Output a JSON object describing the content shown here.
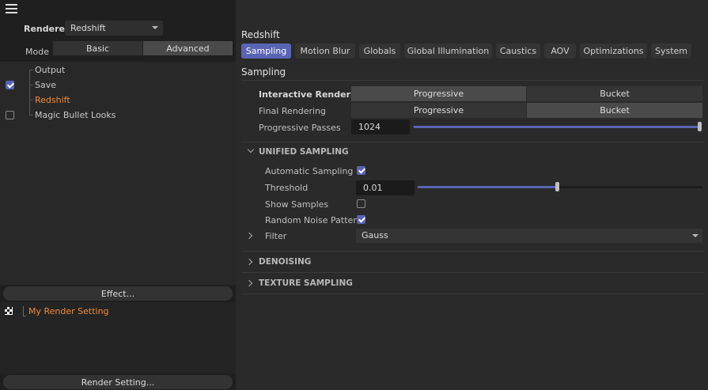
{
  "left": {
    "renderer_label": "Renderer",
    "renderer_value": "Redshift",
    "mode_label": "Mode",
    "mode_options": [
      "Basic",
      "Advanced"
    ],
    "mode_selected": "Advanced",
    "tree": [
      {
        "label": "Output",
        "checkbox": null
      },
      {
        "label": "Save",
        "checkbox": true
      },
      {
        "label": "Redshift",
        "checkbox": null,
        "highlighted": true
      },
      {
        "label": "Magic Bullet Looks",
        "checkbox": false
      }
    ],
    "effect_button": "Effect...",
    "render_settings": [
      "My Render Setting"
    ],
    "render_setting_button": "Render Setting..."
  },
  "right": {
    "title": "Redshift",
    "tabs": [
      "Sampling",
      "Motion Blur",
      "Globals",
      "Global Illumination",
      "Caustics",
      "AOV",
      "Optimizations",
      "System"
    ],
    "active_tab": "Sampling",
    "section": "Sampling",
    "interactive_rendering": {
      "label": "Interactive Rendering",
      "options": [
        "Progressive",
        "Bucket"
      ],
      "selected": "Progressive"
    },
    "final_rendering": {
      "label": "Final Rendering",
      "options": [
        "Progressive",
        "Bucket"
      ],
      "selected": "Bucket"
    },
    "progressive_passes": {
      "label": "Progressive Passes",
      "value": "1024",
      "slider_fraction": 1.0
    },
    "unified_sampling": {
      "header": "UNIFIED SAMPLING",
      "automatic_sampling": {
        "label": "Automatic Sampling",
        "checked": true
      },
      "threshold": {
        "label": "Threshold",
        "value": "0.01",
        "slider_fraction": 0.49
      },
      "show_samples": {
        "label": "Show Samples",
        "checked": false
      },
      "random_noise_pattern": {
        "label": "Random Noise Pattern",
        "checked": true
      },
      "filter": {
        "label": "Filter",
        "value": "Gauss"
      }
    },
    "denoising_header": "DENOISING",
    "texture_sampling_header": "TEXTURE SAMPLING"
  },
  "colors": {
    "accent": "#5a64b4",
    "highlight": "#f08a3c"
  }
}
